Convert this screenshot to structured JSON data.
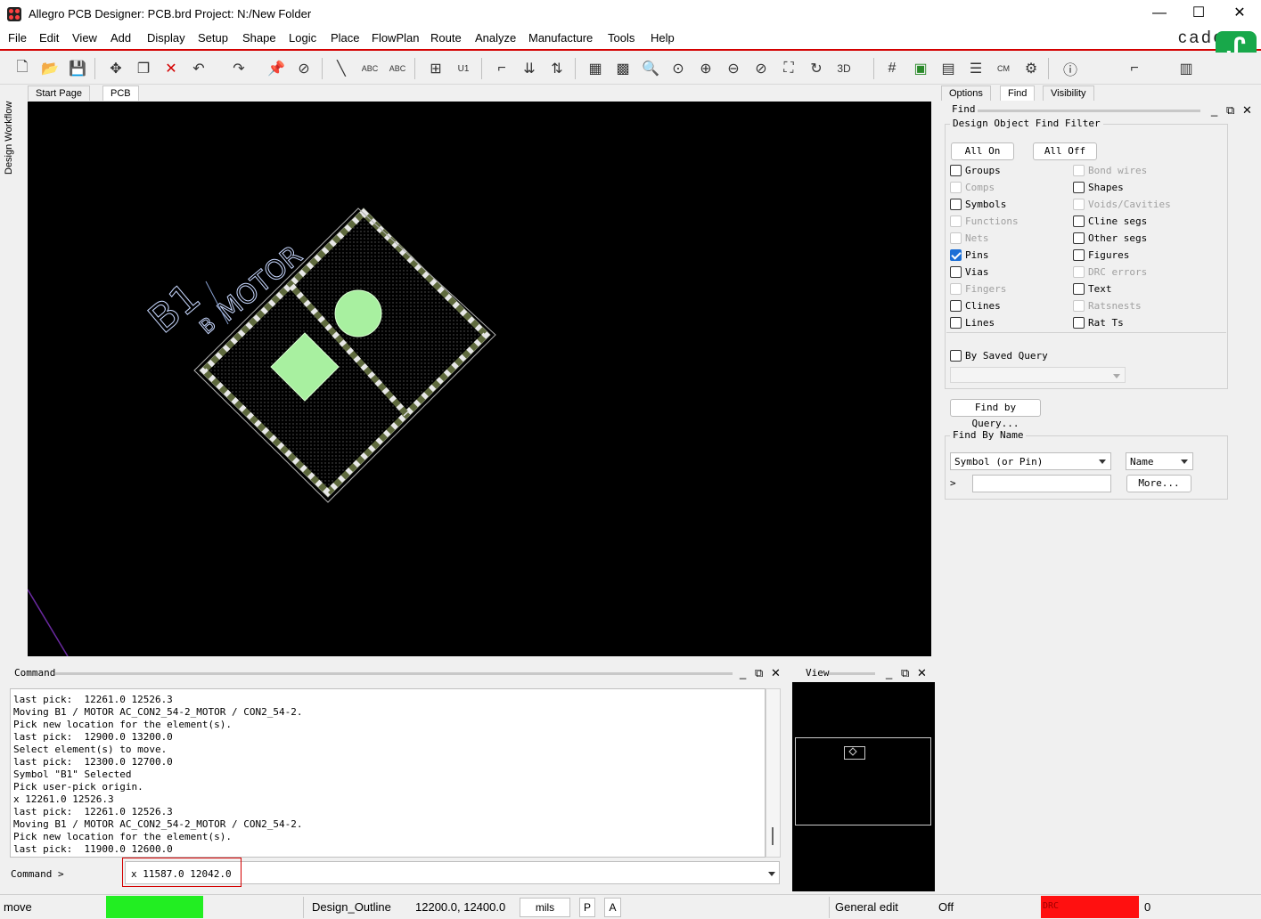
{
  "window": {
    "title": "Allegro PCB Designer: PCB.brd  Project: N:/New Folder",
    "minimize": "—",
    "maximize": "☐",
    "close": "✕"
  },
  "menu": [
    "File",
    "Edit",
    "View",
    "Add",
    "Display",
    "Setup",
    "Shape",
    "Logic",
    "Place",
    "FlowPlan",
    "Route",
    "Analyze",
    "Manufacture",
    "Tools",
    "Help"
  ],
  "brand": {
    "text": "cade",
    "logo": "ᔑ"
  },
  "side_tab": "Design Workflow",
  "doc_tabs": [
    "Start Page",
    "PCB"
  ],
  "canvas": {
    "refdes": "B1",
    "pin_label": "B",
    "value_label": "MOTOR",
    "colors": {
      "background": "#000000",
      "pad": "#a8f0a0",
      "outline": "#9aa08c",
      "text": "#c8d8ff"
    }
  },
  "command": {
    "title": "Command",
    "log": [
      "last pick:  12261.0 12526.3",
      "Moving B1 / MOTOR AC_CON2_54-2_MOTOR / CON2_54-2.",
      "Pick new location for the element(s).",
      "last pick:  12900.0 13200.0",
      "Select element(s) to move.",
      "last pick:  12300.0 12700.0",
      "Symbol \"B1\" Selected",
      "Pick user-pick origin.",
      "x 12261.0 12526.3",
      "last pick:  12261.0 12526.3",
      "Moving B1 / MOTOR AC_CON2_54-2_MOTOR / CON2_54-2.",
      "Pick new location for the element(s).",
      "last pick:  11900.0 12600.0"
    ],
    "prompt": "Command >",
    "input_value": "x 11587.0 12042.0"
  },
  "view_panel": {
    "title": "View"
  },
  "right_tabs": [
    "Options",
    "Find",
    "Visibility"
  ],
  "find": {
    "title": "Find",
    "filter_title": "Design Object Find Filter",
    "all_on": "All On",
    "all_off": "All Off",
    "left_items": [
      {
        "label": "Groups",
        "checked": false,
        "disabled": false
      },
      {
        "label": "Comps",
        "checked": false,
        "disabled": true
      },
      {
        "label": "Symbols",
        "checked": false,
        "disabled": false
      },
      {
        "label": "Functions",
        "checked": false,
        "disabled": true
      },
      {
        "label": "Nets",
        "checked": false,
        "disabled": true
      },
      {
        "label": "Pins",
        "checked": true,
        "disabled": false
      },
      {
        "label": "Vias",
        "checked": false,
        "disabled": false
      },
      {
        "label": "Fingers",
        "checked": false,
        "disabled": true
      },
      {
        "label": "Clines",
        "checked": false,
        "disabled": false
      },
      {
        "label": "Lines",
        "checked": false,
        "disabled": false
      }
    ],
    "right_items": [
      {
        "label": "Bond wires",
        "checked": false,
        "disabled": true
      },
      {
        "label": "Shapes",
        "checked": false,
        "disabled": false
      },
      {
        "label": "Voids/Cavities",
        "checked": false,
        "disabled": true
      },
      {
        "label": "Cline segs",
        "checked": false,
        "disabled": false
      },
      {
        "label": "Other segs",
        "checked": false,
        "disabled": false
      },
      {
        "label": "Figures",
        "checked": false,
        "disabled": false
      },
      {
        "label": "DRC errors",
        "checked": false,
        "disabled": true
      },
      {
        "label": "Text",
        "checked": false,
        "disabled": false
      },
      {
        "label": "Ratsnests",
        "checked": false,
        "disabled": true
      },
      {
        "label": "Rat Ts",
        "checked": false,
        "disabled": false
      }
    ],
    "by_saved_query": "By Saved Query",
    "find_by_query": "Find by Query...",
    "find_by_name_title": "Find By Name",
    "name_type": "Symbol (or Pin)",
    "name_mode": "Name",
    "more": "More...",
    "name_prompt": ">"
  },
  "status": {
    "mode": "move",
    "mode_color": "#22ee22",
    "class": "Design_Outline",
    "coords": "12200.0, 12400.0",
    "units": "mils",
    "p": "P",
    "a": "A",
    "edit_mode": "General edit",
    "off": "Off",
    "drc_label": "DRC",
    "drc_color": "#ff1010",
    "drc_count": "0"
  }
}
